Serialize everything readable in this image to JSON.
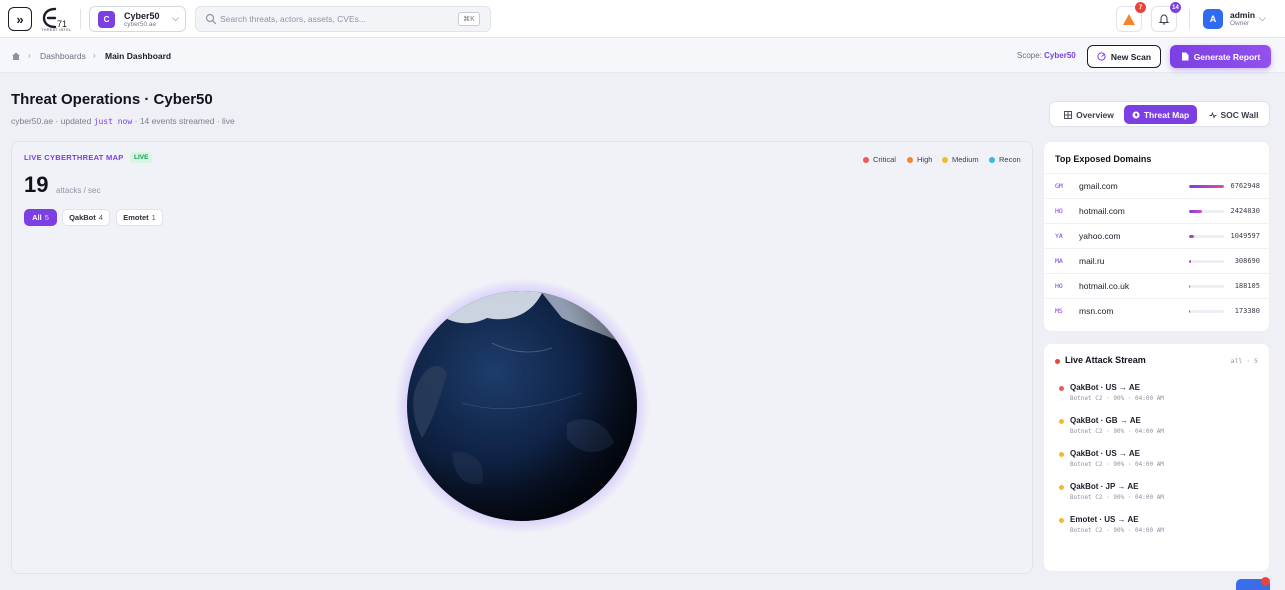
{
  "topbar": {
    "logo_sub": "THREAT INTEL",
    "tenant": {
      "initial": "C",
      "name": "Cyber50",
      "domain": "cyber50.ae"
    },
    "search": {
      "placeholder": "Search threats, actors, assets, CVEs...",
      "shortcut": "⌘K"
    },
    "alerts_count": "7",
    "notifications_count": "14",
    "user": {
      "initial": "A",
      "name": "admin",
      "role": "Owner"
    }
  },
  "breadcrumb": {
    "parent": "Dashboards",
    "current": "Main Dashboard"
  },
  "scope": {
    "label": "Scope:",
    "value": "Cyber50"
  },
  "actions": {
    "new_scan": "New Scan",
    "generate_report": "Generate Report"
  },
  "header": {
    "title": "Threat Operations · Cyber50",
    "sub_prefix": "cyber50.ae · updated",
    "sub_time": "just now",
    "sub_suffix": "· 14 events streamed · live"
  },
  "view_tabs": [
    {
      "label": "Overview",
      "active": false
    },
    {
      "label": "Threat Map",
      "active": true
    },
    {
      "label": "SOC Wall",
      "active": false
    }
  ],
  "map": {
    "label": "LIVE CYBERTHREAT MAP",
    "live_badge": "LIVE",
    "attacks_per_sec": "19",
    "attacks_unit": "attacks / sec",
    "filters": [
      {
        "label": "All",
        "count": "5",
        "active": true
      },
      {
        "label": "QakBot",
        "count": "4",
        "active": false
      },
      {
        "label": "Emotet",
        "count": "1",
        "active": false
      }
    ],
    "legend": [
      {
        "label": "Critical",
        "color": "#f0595a"
      },
      {
        "label": "High",
        "color": "#f5842a"
      },
      {
        "label": "Medium",
        "color": "#f5b82a"
      },
      {
        "label": "Recon",
        "color": "#3bb5e8"
      }
    ]
  },
  "domains": {
    "title": "Top Exposed Domains",
    "rows": [
      {
        "abbr": "GM",
        "name": "gmail.com",
        "value": "6762948",
        "fraction": 1.0
      },
      {
        "abbr": "HO",
        "name": "hotmail.com",
        "value": "2424030",
        "fraction": 0.358
      },
      {
        "abbr": "YA",
        "name": "yahoo.com",
        "value": "1049597",
        "fraction": 0.155
      },
      {
        "abbr": "MA",
        "name": "mail.ru",
        "value": "308690",
        "fraction": 0.046
      },
      {
        "abbr": "HO",
        "name": "hotmail.co.uk",
        "value": "188105",
        "fraction": 0.028
      },
      {
        "abbr": "MS",
        "name": "msn.com",
        "value": "173380",
        "fraction": 0.026
      }
    ]
  },
  "stream": {
    "title": "Live Attack Stream",
    "meta": "all · 5",
    "events": [
      {
        "title": "QakBot · US → AE",
        "detail": "Botnet C2 · 90% · 04:00 AM",
        "color": "#f0595a"
      },
      {
        "title": "QakBot · GB → AE",
        "detail": "Botnet C2 · 90% · 04:00 AM",
        "color": "#f5b82a"
      },
      {
        "title": "QakBot · US → AE",
        "detail": "Botnet C2 · 90% · 04:00 AM",
        "color": "#f5b82a"
      },
      {
        "title": "QakBot · JP → AE",
        "detail": "Botnet C2 · 90% · 04:00 AM",
        "color": "#f5b82a"
      },
      {
        "title": "Emotet · US → AE",
        "detail": "Botnet C2 · 90% · 04:00 AM",
        "color": "#f5b82a"
      }
    ]
  },
  "colors": {
    "accent": "#7b3fe4",
    "alert": "#f5842a",
    "danger": "#e8443a"
  }
}
